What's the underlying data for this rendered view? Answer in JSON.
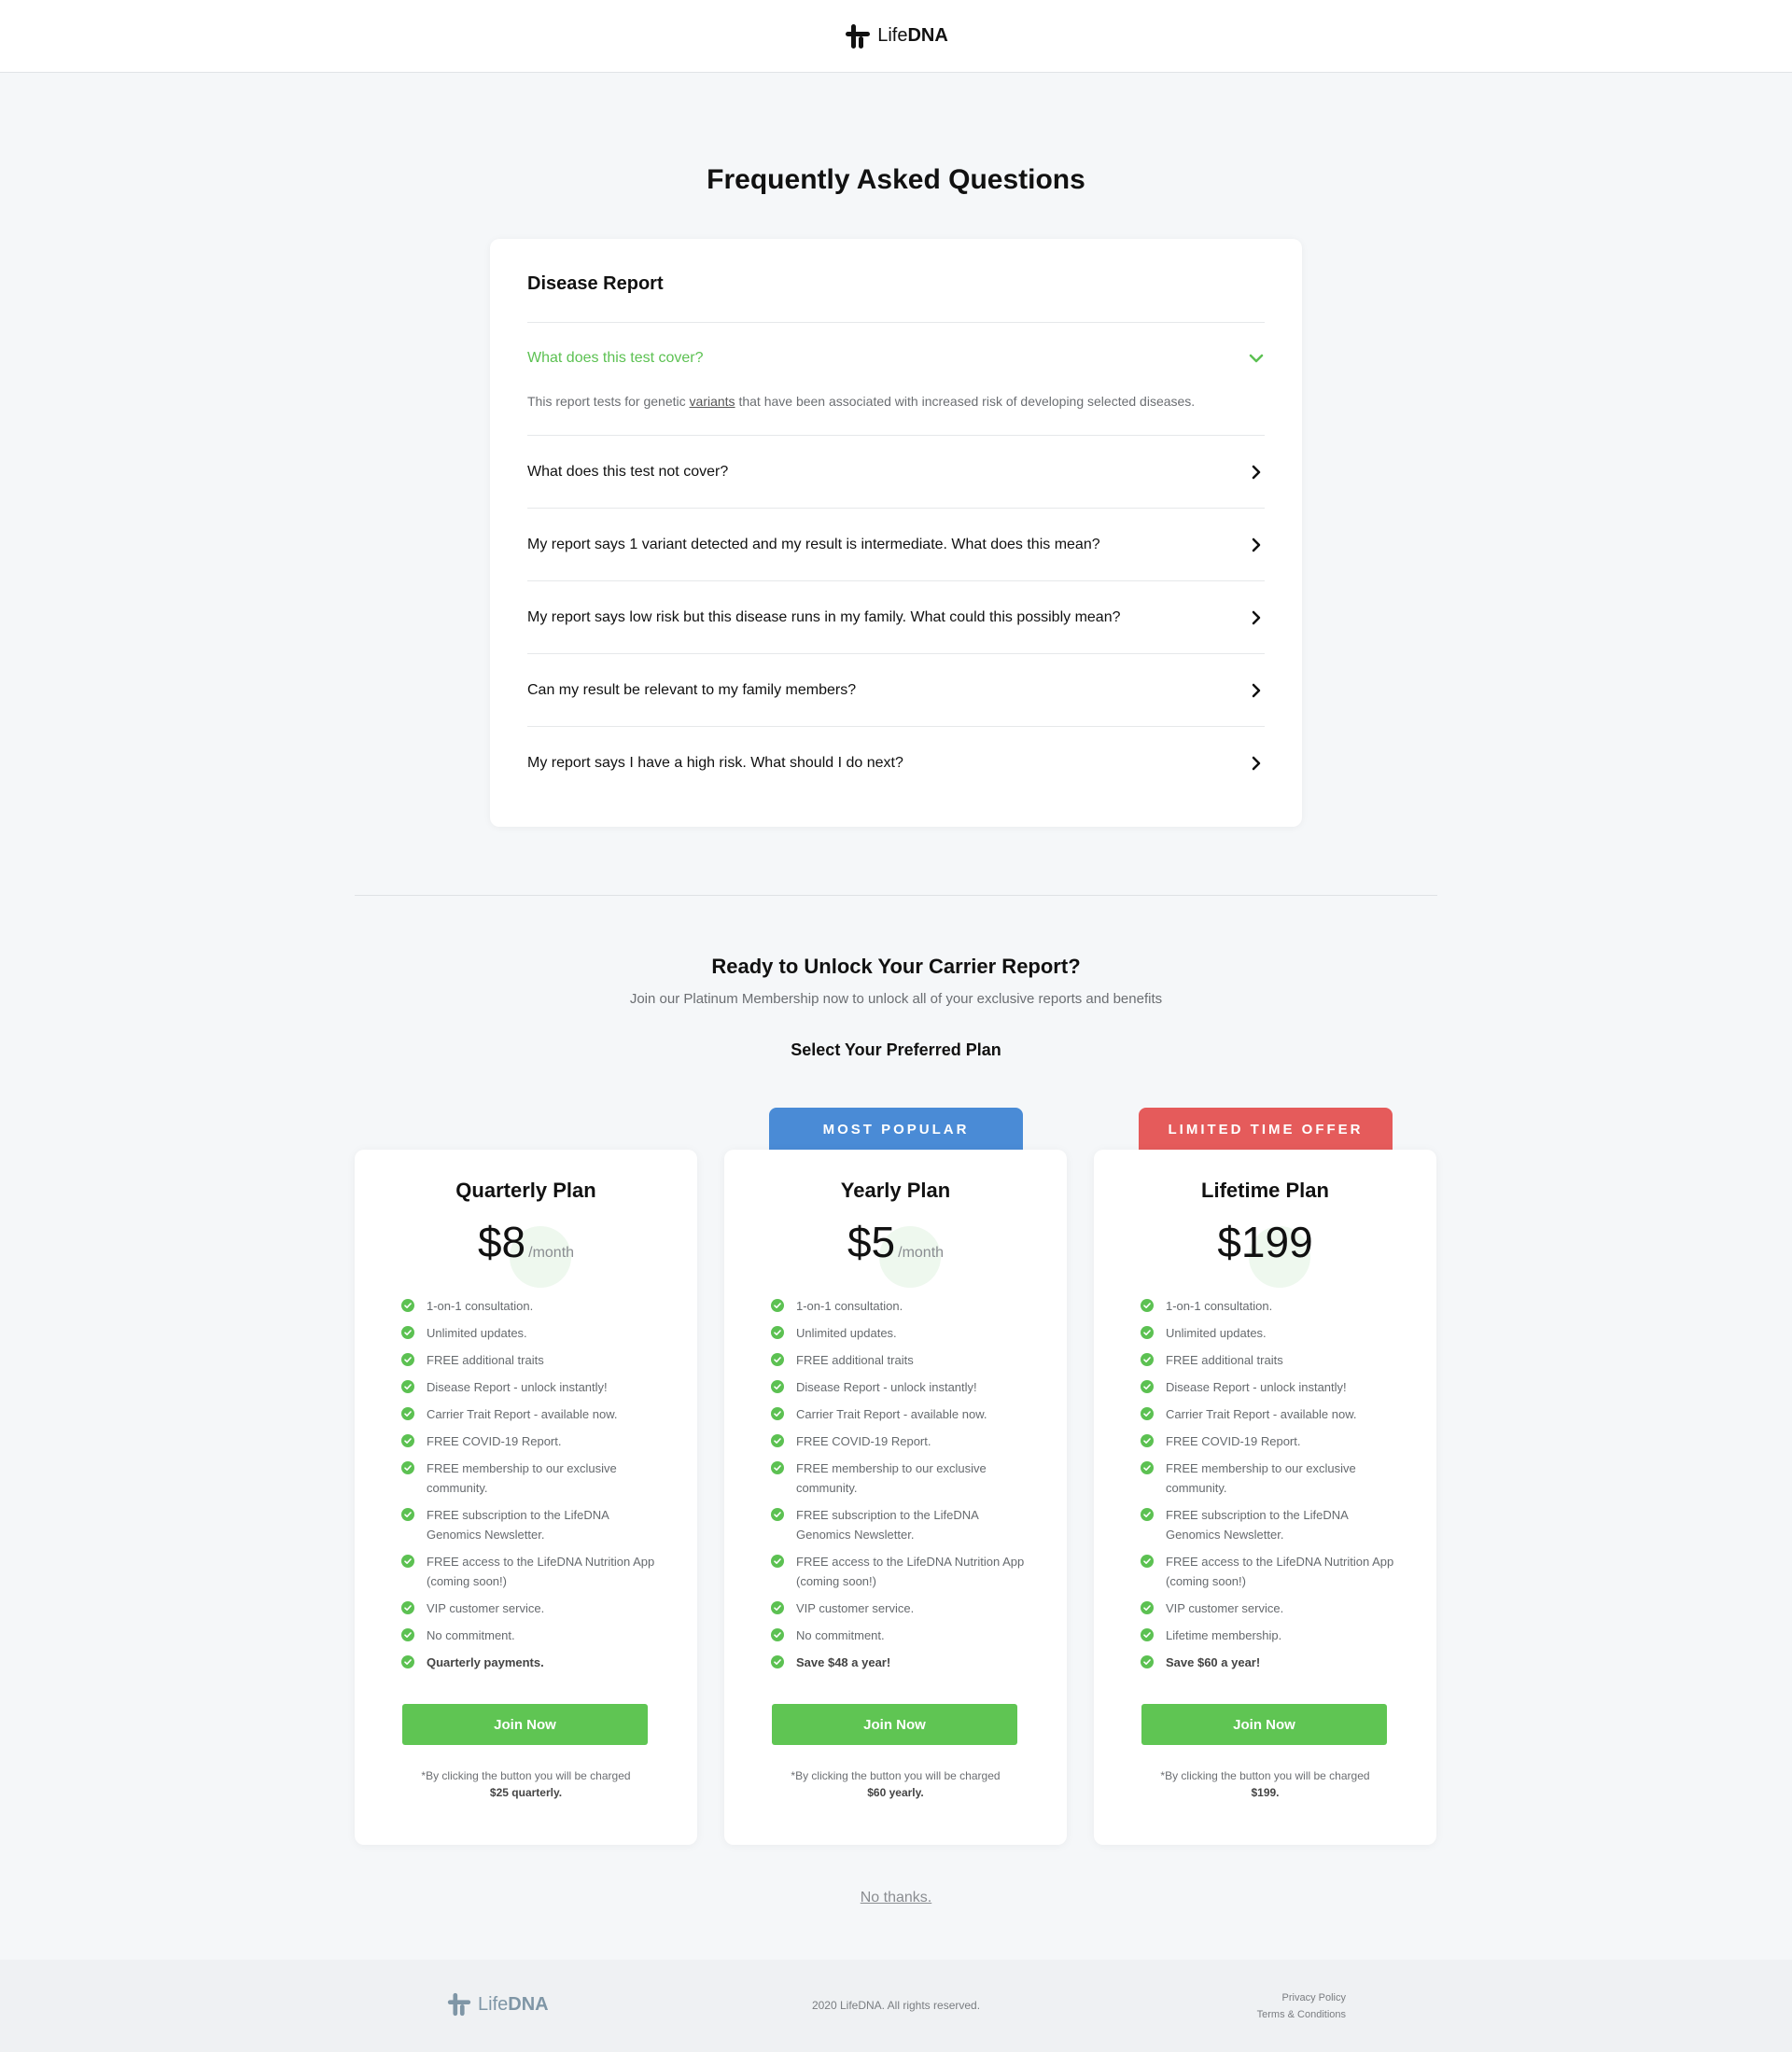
{
  "header": {
    "logo_light": "Life",
    "logo_bold": "DNA"
  },
  "faq": {
    "title": "Frequently Asked Questions",
    "section": "Disease Report",
    "items": [
      {
        "q": "What does this test cover?",
        "a_before": "This report tests for genetic ",
        "a_link": "variants",
        "a_after": " that have been associated with increased risk of developing selected diseases."
      },
      {
        "q": "What does this test not cover?"
      },
      {
        "q": "My report says 1 variant detected and my result is intermediate. What does this mean?"
      },
      {
        "q": "My report says low risk but this disease runs in my family. What could this possibly mean?"
      },
      {
        "q": "Can my result be relevant to my family members?"
      },
      {
        "q": "My report says I have a high risk. What should I do next?"
      }
    ]
  },
  "cta": {
    "title": "Ready to Unlock Your Carrier Report?",
    "subtitle": "Join our Platinum Membership now to unlock all of your exclusive reports and benefits",
    "select": "Select Your Preferred Plan"
  },
  "plans": [
    {
      "name": "Quarterly Plan",
      "price": "$8",
      "per": "/month",
      "ribbon": "",
      "features": [
        "1-on-1 consultation.",
        "Unlimited updates.",
        "FREE additional traits",
        "Disease Report - unlock instantly!",
        "Carrier Trait Report - available now.",
        "FREE COVID-19 Report.",
        "FREE membership to our exclusive community.",
        "FREE subscription to the LifeDNA Genomics Newsletter.",
        "FREE access to the LifeDNA Nutrition App (coming soon!)",
        "VIP customer service.",
        "No commitment.",
        "Quarterly payments."
      ],
      "button": "Join Now",
      "note_prefix": "*By clicking the button you will be charged ",
      "note_bold": "$25 quarterly."
    },
    {
      "name": "Yearly Plan",
      "price": "$5",
      "per": "/month",
      "ribbon": "MOST POPULAR",
      "features": [
        "1-on-1 consultation.",
        "Unlimited updates.",
        "FREE additional traits",
        "Disease Report - unlock instantly!",
        "Carrier Trait Report - available now.",
        "FREE COVID-19 Report.",
        "FREE membership to our exclusive community.",
        "FREE subscription to the LifeDNA Genomics Newsletter.",
        "FREE access to the LifeDNA Nutrition App (coming soon!)",
        "VIP customer service.",
        "No commitment.",
        "Save $48 a year!"
      ],
      "button": "Join Now",
      "note_prefix": "*By clicking the button you will be charged ",
      "note_bold": "$60 yearly."
    },
    {
      "name": "Lifetime Plan",
      "price": "$199",
      "per": "",
      "ribbon": "LIMITED TIME OFFER",
      "features": [
        "1-on-1 consultation.",
        "Unlimited updates.",
        "FREE additional traits",
        "Disease Report - unlock instantly!",
        "Carrier Trait Report - available now.",
        "FREE COVID-19 Report.",
        "FREE membership to our exclusive community.",
        "FREE subscription to the LifeDNA Genomics Newsletter.",
        "FREE access to the LifeDNA Nutrition App (coming soon!)",
        "VIP customer service.",
        "Lifetime membership.",
        "Save $60 a year!"
      ],
      "button": "Join Now",
      "note_prefix": "*By clicking the button you will be charged ",
      "note_bold": "$199."
    }
  ],
  "no_thanks": "No thanks.",
  "footer": {
    "logo_light": "Life",
    "logo_bold": "DNA",
    "copyright": "2020 LifeDNA. All rights reserved.",
    "privacy": "Privacy Policy",
    "terms": "Terms & Conditions"
  },
  "colors": {
    "accent": "#5cc152",
    "ribbon_popular": "#4a8bd6",
    "ribbon_limited": "#e55b5b"
  }
}
